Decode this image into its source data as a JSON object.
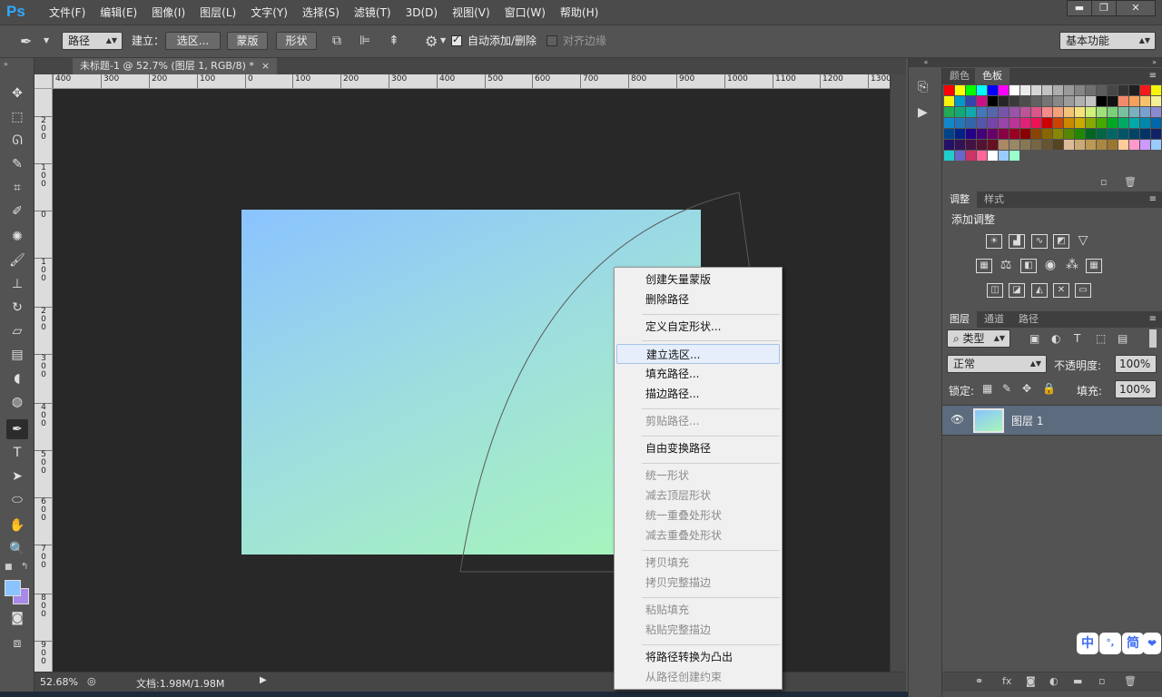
{
  "app": {
    "logo": "Ps"
  },
  "menubar": {
    "items": [
      "文件(F)",
      "编辑(E)",
      "图像(I)",
      "图层(L)",
      "文字(Y)",
      "选择(S)",
      "滤镜(T)",
      "3D(D)",
      "视图(V)",
      "窗口(W)",
      "帮助(H)"
    ]
  },
  "window_controls": {
    "minimize": "▬",
    "restore": "❐",
    "close": "✕"
  },
  "optionsbar": {
    "mode_select": "路径",
    "make_label": "建立：",
    "selection_button": "选区...",
    "mask_button": "蒙版",
    "shape_button": "形状",
    "auto_add_delete": "自动添加/删除",
    "auto_add_checked": true,
    "align_edges": "对齐边缘",
    "align_checked": false,
    "workspace": "基本功能"
  },
  "document": {
    "tab_title": "未标题-1 @ 52.7% (图层 1, RGB/8) *",
    "tab_close": "×",
    "zoom": "52.68%",
    "doc_info": "文档:1.98M/1.98M"
  },
  "ruler_top": [
    "400",
    "300",
    "200",
    "100",
    "0",
    "100",
    "200",
    "300",
    "400",
    "500",
    "600",
    "700",
    "800",
    "900",
    "1000",
    "1100",
    "1200",
    "1300"
  ],
  "ruler_left": [
    "2\n0\n0",
    "1\n0\n0",
    "0",
    "1\n0\n0",
    "2\n0\n0",
    "3\n0\n0",
    "4\n0\n0",
    "5\n0\n0",
    "6\n0\n0",
    "7\n0\n0",
    "8\n0\n0",
    "9\n0\n0"
  ],
  "context_menu": {
    "items": [
      {
        "label": "创建矢量蒙版",
        "disabled": false
      },
      {
        "label": "删除路径",
        "disabled": false
      },
      {
        "label": "定义自定形状...",
        "disabled": false
      },
      {
        "label": "建立选区...",
        "disabled": false,
        "hover": true
      },
      {
        "label": "填充路径...",
        "disabled": false
      },
      {
        "label": "描边路径...",
        "disabled": false
      },
      {
        "label": "剪贴路径...",
        "disabled": true
      },
      {
        "label": "自由变换路径",
        "disabled": false
      },
      {
        "label": "统一形状",
        "disabled": true
      },
      {
        "label": "减去顶层形状",
        "disabled": true
      },
      {
        "label": "统一重叠处形状",
        "disabled": true
      },
      {
        "label": "减去重叠处形状",
        "disabled": true
      },
      {
        "label": "拷贝填充",
        "disabled": true
      },
      {
        "label": "拷贝完整描边",
        "disabled": true
      },
      {
        "label": "粘贴填充",
        "disabled": true
      },
      {
        "label": "粘贴完整描边",
        "disabled": true
      },
      {
        "label": "将路径转换为凸出",
        "disabled": false
      },
      {
        "label": "从路径创建约束",
        "disabled": true
      }
    ]
  },
  "panels": {
    "color_tabs": [
      "颜色",
      "色板"
    ],
    "adjust_tabs": [
      "调整",
      "样式"
    ],
    "add_adjustment": "添加调整",
    "layers_tabs": [
      "图层",
      "通道",
      "路径"
    ],
    "filter_type": "类型",
    "blend_mode": "正常",
    "opacity_label": "不透明度:",
    "opacity_value": "100%",
    "lock_label": "锁定:",
    "fill_label": "填充:",
    "fill_value": "100%",
    "layer_name": "图层 1"
  },
  "ime": [
    "中",
    "°,",
    "简",
    "❤"
  ],
  "colors": {
    "accent_ps": "#31a8ff",
    "swatches": [
      "#ff0000",
      "#ffff00",
      "#00ff00",
      "#00ffff",
      "#0000ff",
      "#ff00ff",
      "#ffffff",
      "#ebebeb",
      "#d6d6d6",
      "#c2c2c2",
      "#adadad",
      "#999999",
      "#858585",
      "#707070",
      "#5c5c5c",
      "#474747",
      "#333333",
      "#1f1f1f",
      "#f5191a",
      "#f5f50a",
      "#f5f30e",
      "#0099cc",
      "#3344aa",
      "#cc1188",
      "#000000",
      "#262626",
      "#3a3a3a",
      "#4d4d4d",
      "#616161",
      "#757575",
      "#888888",
      "#9c9c9c",
      "#b0b0b0",
      "#c4c4c4",
      "#000000",
      "#111111",
      "#f58a6a",
      "#f5a15c",
      "#f5c36b",
      "#f5f096",
      "#22aa55",
      "#11aa77",
      "#11aaaa",
      "#4477bb",
      "#5566aa",
      "#7755aa",
      "#9955aa",
      "#bb5599",
      "#dd5588",
      "#f58a8a",
      "#f5a27a",
      "#f5c27a",
      "#f5e27a",
      "#d0f07a",
      "#a0e07a",
      "#7ad07a",
      "#7ac0a0",
      "#7ab0c0",
      "#7aa0d0",
      "#8a8ad0",
      "#1188cc",
      "#2277bb",
      "#3366aa",
      "#5555aa",
      "#7744aa",
      "#9944aa",
      "#bb3399",
      "#dd2277",
      "#ee1155",
      "#cc0000",
      "#cc4400",
      "#cc8800",
      "#ccaa00",
      "#88aa00",
      "#44aa00",
      "#00aa22",
      "#00aa66",
      "#00aaaa",
      "#0088aa",
      "#0066aa",
      "#004488",
      "#002288",
      "#220088",
      "#440077",
      "#660066",
      "#880044",
      "#990022",
      "#880000",
      "#884400",
      "#886600",
      "#888800",
      "#558800",
      "#228800",
      "#006622",
      "#006644",
      "#006666",
      "#005566",
      "#004466",
      "#003366",
      "#112266",
      "#221166",
      "#331155",
      "#441144",
      "#551133",
      "#661122",
      "#aa8866",
      "#998866",
      "#887755",
      "#776644",
      "#665533",
      "#554422",
      "#ddbb99",
      "#ccaa77",
      "#bb9955",
      "#aa8844",
      "#997733",
      "#ffcc99",
      "#ff99cc",
      "#cc99ff",
      "#99ccff",
      "#22cccc",
      "#6666cc",
      "#cc3366",
      "#ff6699",
      "#ffffff",
      "#99ccff",
      "#99ffcc"
    ]
  }
}
